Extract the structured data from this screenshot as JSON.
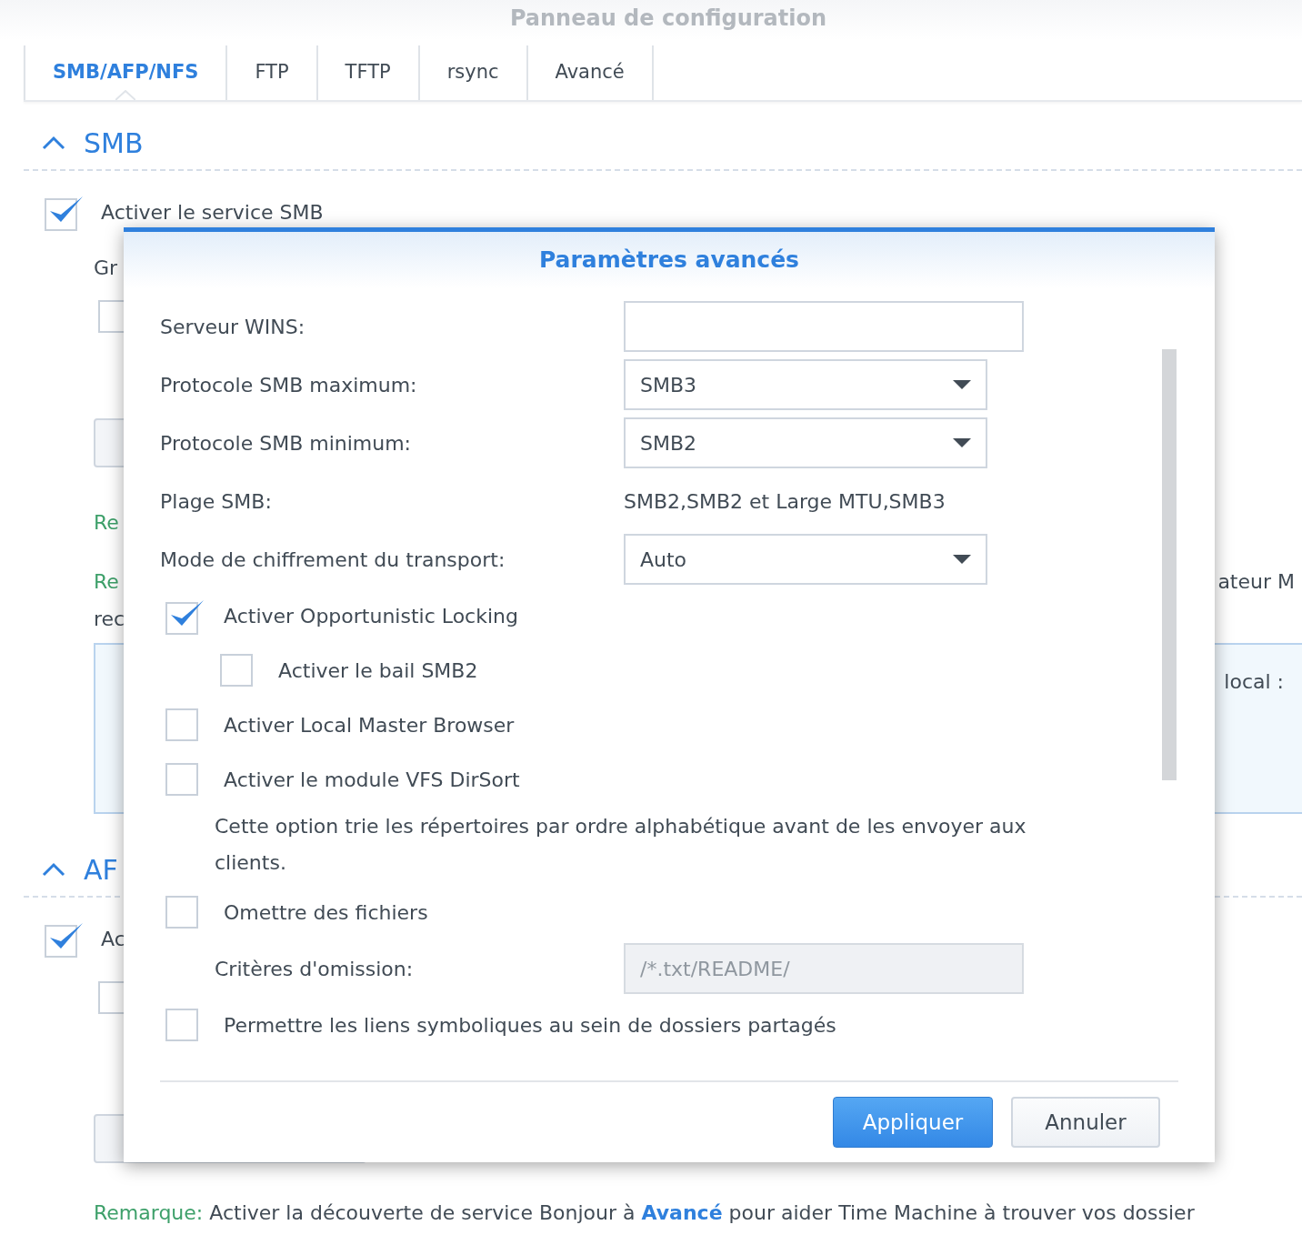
{
  "window": {
    "title": "Panneau de configuration"
  },
  "tabs": [
    {
      "label": "SMB/AFP/NFS",
      "selected": true
    },
    {
      "label": "FTP",
      "selected": false
    },
    {
      "label": "TFTP",
      "selected": false
    },
    {
      "label": "rsync",
      "selected": false
    },
    {
      "label": "Avancé",
      "selected": false
    }
  ],
  "smb_section": {
    "title": "SMB",
    "expanded": true,
    "service": {
      "label": "Activer le service SMB",
      "checked": true
    },
    "row_1": "Gr",
    "checkbox_1": {
      "checked": false
    },
    "note_1": "Re",
    "note_2": "Re",
    "note_2_right": "ateur M",
    "note_2_line2": "rec",
    "info_box": {
      "right": "local :"
    }
  },
  "afp_section": {
    "title": "AF",
    "expanded": true,
    "service": {
      "label": "Ac",
      "checked": true
    },
    "checkbox_1": {
      "checked": false
    }
  },
  "remark": {
    "label": "Remarque:",
    "text_before": "Activer la découverte de service Bonjour à",
    "link": "Avancé",
    "text_after": "pour aider Time Machine à trouver vos dossier"
  },
  "dialog": {
    "title": "Paramètres avancés",
    "items": [
      {
        "kind": "input",
        "label": "Serveur WINS:",
        "disabled": false
      },
      {
        "kind": "select",
        "label": "Protocole SMB maximum:",
        "value": "SMB3"
      },
      {
        "kind": "select",
        "label": "Protocole SMB minimum:",
        "value": "SMB2"
      },
      {
        "kind": "readonly",
        "label": "Plage SMB:",
        "value": "SMB2,SMB2 et Large MTU,SMB3"
      },
      {
        "kind": "select",
        "label": "Mode de chiffrement du transport:",
        "value": "Auto"
      },
      {
        "kind": "checkbox",
        "label": "Activer Opportunistic Locking",
        "checked": true,
        "children": [
          {
            "kind": "checkbox",
            "label": "Activer le bail SMB2",
            "checked": false
          }
        ]
      },
      {
        "kind": "checkbox",
        "label": "Activer Local Master Browser",
        "checked": false
      },
      {
        "kind": "checkbox",
        "label": "Activer le module VFS DirSort",
        "checked": false,
        "children": [
          {
            "kind": "note",
            "text": "Cette option trie les répertoires par ordre alphabétique avant de les envoyer aux clients."
          }
        ]
      },
      {
        "kind": "checkbox",
        "label": "Omettre des fichiers",
        "checked": false,
        "children": [
          {
            "kind": "input",
            "label": "Critères d'omission:",
            "placeholder": "/*.txt/README/",
            "disabled": true
          }
        ]
      },
      {
        "kind": "checkbox",
        "label": "Permettre les liens symboliques au sein de dossiers partagés",
        "checked": false
      }
    ],
    "buttons": [
      {
        "label": "Appliquer",
        "primary": true
      },
      {
        "label": "Annuler",
        "primary": false
      }
    ]
  }
}
